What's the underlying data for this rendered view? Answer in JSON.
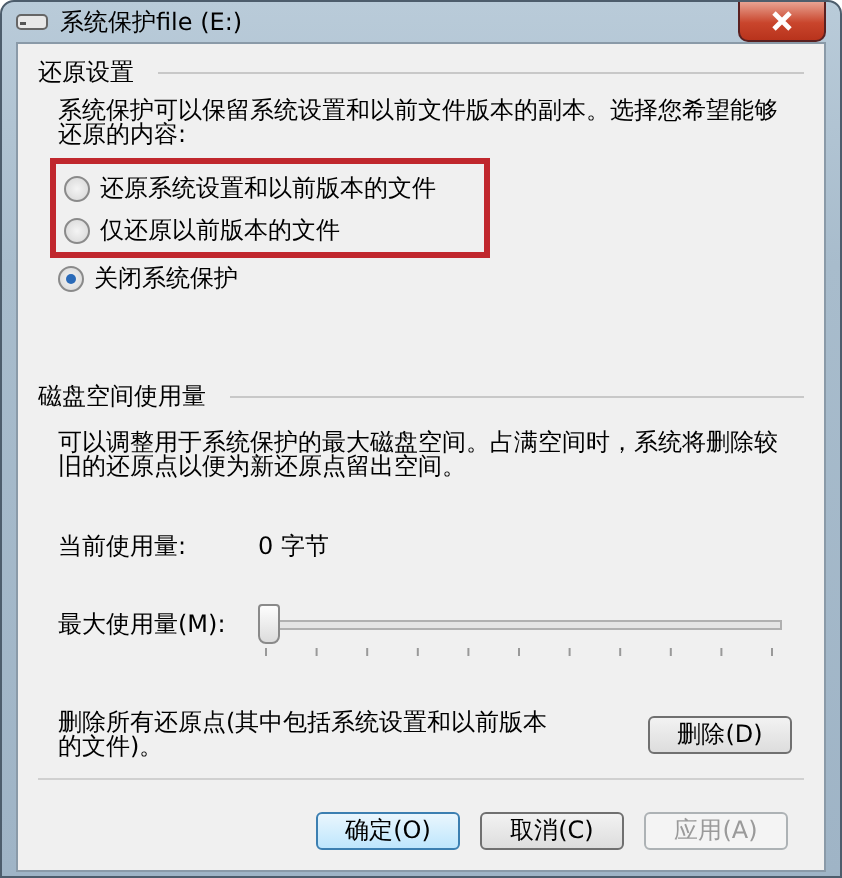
{
  "window": {
    "title": "系统保护file (E:)"
  },
  "restore_settings": {
    "heading": "还原设置",
    "description": "系统保护可以保留系统设置和以前文件版本的副本。选择您希望能够还原的内容:",
    "options": [
      {
        "label": "还原系统设置和以前版本的文件",
        "selected": false,
        "highlighted": true
      },
      {
        "label": "仅还原以前版本的文件",
        "selected": false,
        "highlighted": true
      },
      {
        "label": "关闭系统保护",
        "selected": true,
        "highlighted": false
      }
    ]
  },
  "disk_usage": {
    "heading": "磁盘空间使用量",
    "description": "可以调整用于系统保护的最大磁盘空间。占满空间时，系统将删除较旧的还原点以便为新还原点留出空间。",
    "current_label": "当前使用量:",
    "current_value": "0 字节",
    "max_label": "最大使用量(M):",
    "max_slider": {
      "level": 0
    },
    "delete_description": "删除所有还原点(其中包括系统设置和以前版本的文件)。",
    "delete_button": "删除(D)"
  },
  "buttons": [
    {
      "label": "确定(O)",
      "default": true,
      "disabled": false
    },
    {
      "label": "取消(C)",
      "default": false,
      "disabled": false
    },
    {
      "label": "应用(A)",
      "default": false,
      "disabled": true
    }
  ]
}
